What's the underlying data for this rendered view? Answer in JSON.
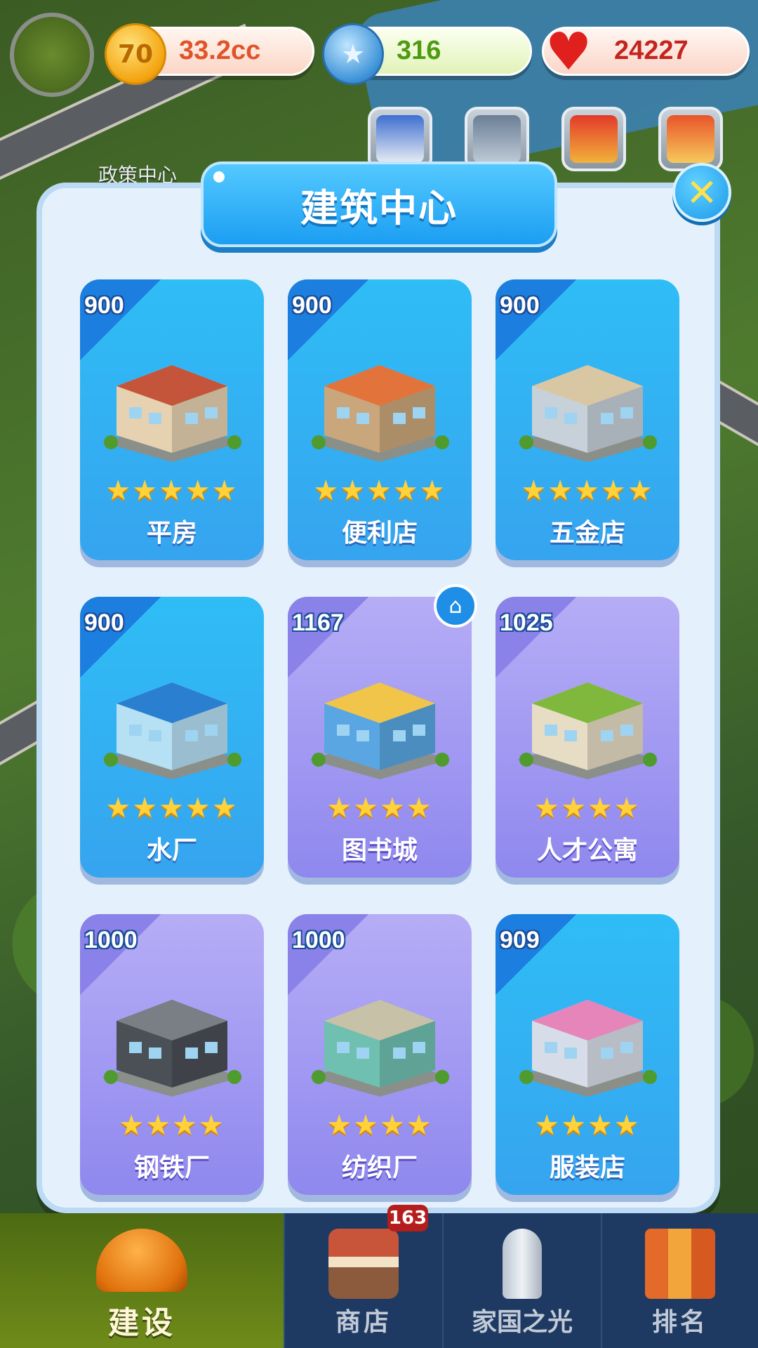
{
  "resources": {
    "gold": "33.2cc",
    "gold_icon_text": "70",
    "stars": "316",
    "hearts": "24227"
  },
  "map": {
    "policy_center_label": "政策中心"
  },
  "modal": {
    "title": "建筑中心",
    "close_symbol": "✕"
  },
  "buildings": [
    {
      "name": "平房",
      "price": "900",
      "stars": 5,
      "stars_text": "★★★★★",
      "card_color": "blue"
    },
    {
      "name": "便利店",
      "price": "900",
      "stars": 5,
      "stars_text": "★★★★★",
      "card_color": "blue"
    },
    {
      "name": "五金店",
      "price": "900",
      "stars": 5,
      "stars_text": "★★★★★",
      "card_color": "blue"
    },
    {
      "name": "水厂",
      "price": "900",
      "stars": 5,
      "stars_text": "★★★★★",
      "card_color": "blue"
    },
    {
      "name": "图书城",
      "price": "1167",
      "stars": 4,
      "stars_text": "★★★★",
      "card_color": "purple"
    },
    {
      "name": "人才公寓",
      "price": "1025",
      "stars": 4,
      "stars_text": "★★★★",
      "card_color": "purple"
    },
    {
      "name": "钢铁厂",
      "price": "1000",
      "stars": 4,
      "stars_text": "★★★★",
      "card_color": "purple"
    },
    {
      "name": "纺织厂",
      "price": "1000",
      "stars": 4,
      "stars_text": "★★★★",
      "card_color": "purple"
    },
    {
      "name": "服装店",
      "price": "909",
      "stars": 4,
      "stars_text": "★★★★",
      "card_color": "blue"
    }
  ],
  "home_badge_symbol": "⌂",
  "bottom_nav": {
    "badge_count": "163",
    "tabs": [
      {
        "label": "建设",
        "active": true
      },
      {
        "label": "商店",
        "active": false
      },
      {
        "label": "家国之光",
        "active": false
      },
      {
        "label": "排名",
        "active": false
      }
    ]
  },
  "colors": {
    "card_blue": "#36a4ef",
    "card_purple": "#8f88ee",
    "title_blue": "#1b9ef2",
    "star_gold": "#ffd23a"
  }
}
